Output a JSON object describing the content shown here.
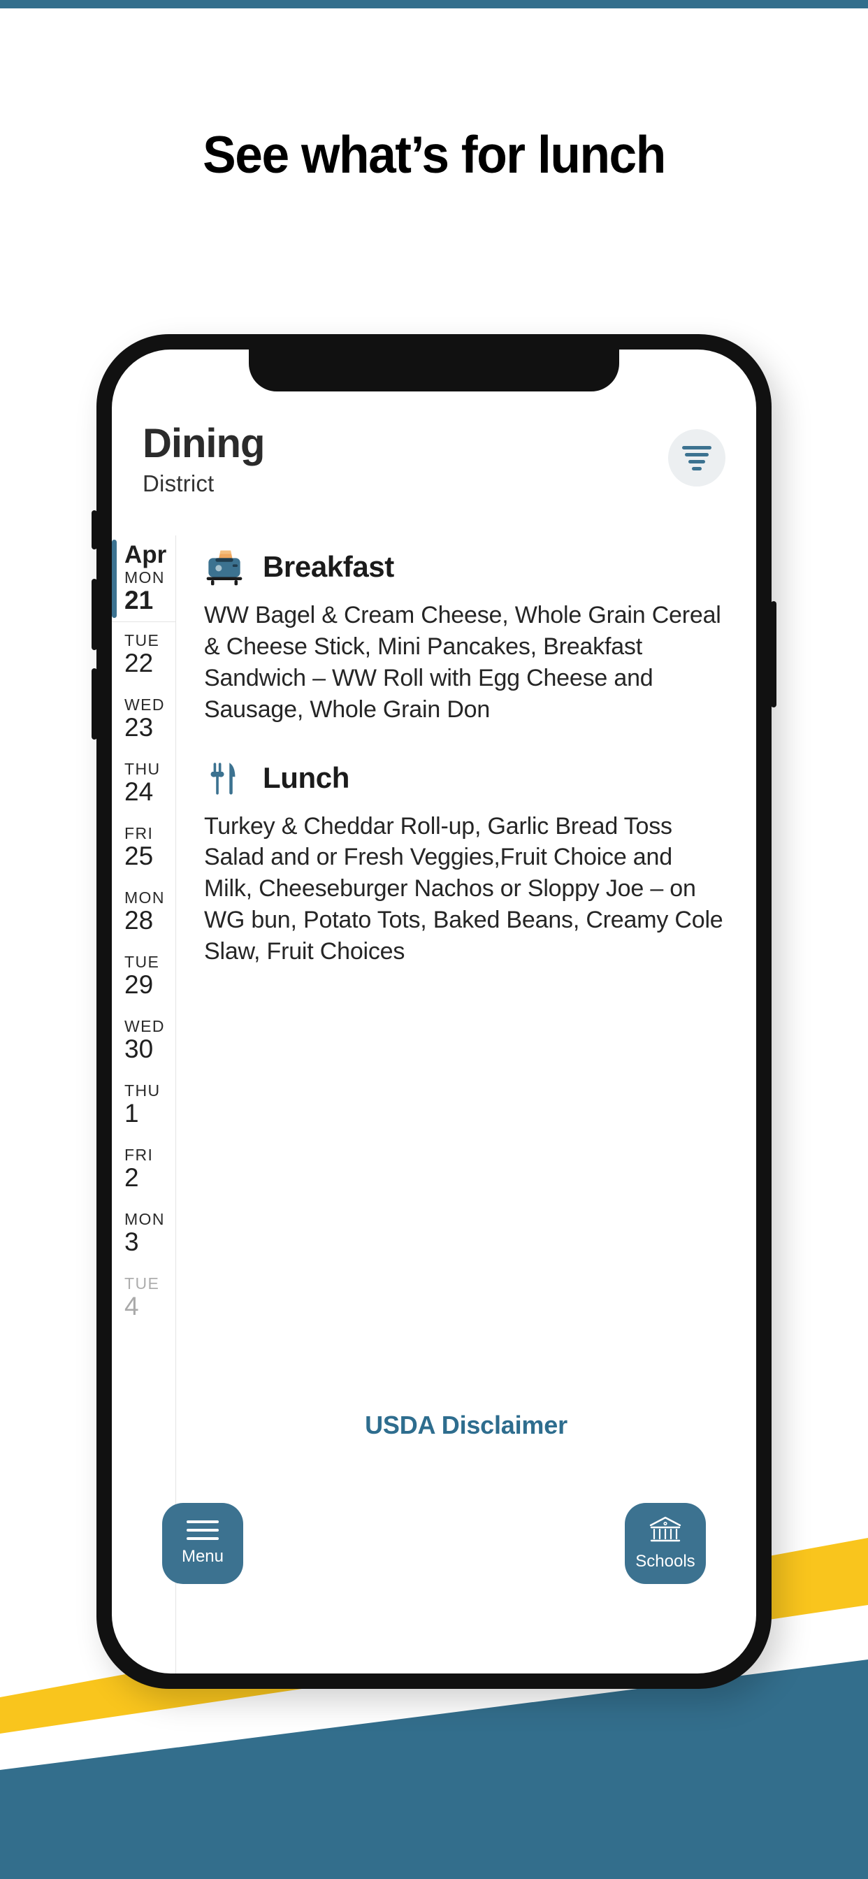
{
  "headline": "See what’s for lunch",
  "colors": {
    "brand_blue": "#3C7290",
    "link_blue": "#2E6D8E",
    "accent_yellow": "#F9C51D",
    "deco_teal": "#336E8C",
    "page_bg": "#FFFFFF"
  },
  "app": {
    "title": "Dining",
    "subtitle": "District",
    "filter_button": {
      "icon": "filter-icon",
      "label": "Filter"
    },
    "dates": [
      {
        "month": "Apr",
        "dow": "MON",
        "day": "21",
        "selected": true
      },
      {
        "month": "",
        "dow": "TUE",
        "day": "22",
        "selected": false
      },
      {
        "month": "",
        "dow": "WED",
        "day": "23",
        "selected": false
      },
      {
        "month": "",
        "dow": "THU",
        "day": "24",
        "selected": false
      },
      {
        "month": "",
        "dow": "FRI",
        "day": "25",
        "selected": false
      },
      {
        "month": "",
        "dow": "MON",
        "day": "28",
        "selected": false
      },
      {
        "month": "",
        "dow": "TUE",
        "day": "29",
        "selected": false
      },
      {
        "month": "",
        "dow": "WED",
        "day": "30",
        "selected": false
      },
      {
        "month": "",
        "dow": "THU",
        "day": "1",
        "selected": false
      },
      {
        "month": "",
        "dow": "FRI",
        "day": "2",
        "selected": false
      },
      {
        "month": "",
        "dow": "MON",
        "day": "3",
        "selected": false
      },
      {
        "month": "",
        "dow": "TUE",
        "day": "4",
        "selected": false,
        "faded": true
      }
    ],
    "meals": [
      {
        "icon": "toaster-icon",
        "title": "Breakfast",
        "description": "WW Bagel & Cream Cheese, Whole Grain Cereal & Cheese Stick, Mini Pancakes, Breakfast Sandwich – WW Roll with Egg Cheese and Sausage, Whole Grain Don"
      },
      {
        "icon": "fork-knife-icon",
        "title": "Lunch",
        "description": "Turkey & Cheddar Roll-up, Garlic Bread Toss Salad and or Fresh Veggies,Fruit Choice and Milk, Cheeseburger Nachos or Sloppy Joe – on WG bun, Potato Tots, Baked Beans, Creamy Cole Slaw, Fruit Choices"
      }
    ],
    "disclaimer_link": "USDA Disclaimer",
    "fabs": [
      {
        "icon": "hamburger-menu-icon",
        "label": "Menu"
      },
      {
        "icon": "school-building-icon",
        "label": "Schools"
      }
    ]
  }
}
